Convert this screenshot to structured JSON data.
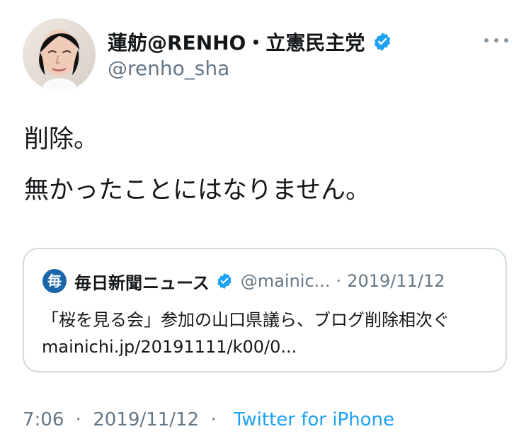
{
  "tweet": {
    "display_name": "蓮舫@RENHO・立憲民主党",
    "handle": "@renho_sha",
    "text_line_1": "削除。",
    "text_line_2": "無かったことにはなりません。",
    "more_icon": "more-icon"
  },
  "quote": {
    "logo_text": "毎",
    "name": "毎日新聞ニュース",
    "handle": "@mainic...",
    "separator": "·",
    "date": "2019/11/12",
    "text": "「桜を見る会」参加の山口県議ら、ブログ削除相次ぐ mainichi.jp/20191111/k00/0..."
  },
  "footer": {
    "time": "7:06",
    "separator": "·",
    "date": "2019/11/12",
    "source": "Twitter for iPhone"
  },
  "colors": {
    "text": "#14171a",
    "muted": "#657786",
    "accent": "#1da1f2",
    "border": "#cfd9de",
    "mainichi_blue": "#1b66a8"
  }
}
